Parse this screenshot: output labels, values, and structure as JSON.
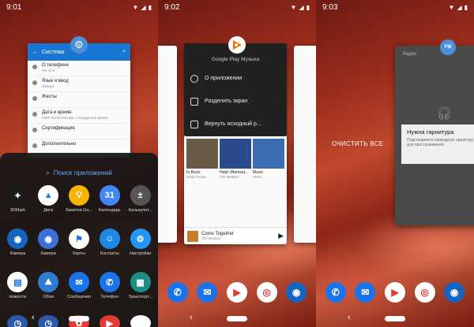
{
  "panels": [
    {
      "time": "9:01",
      "settings_card": {
        "title": "Система",
        "rows": [
          {
            "label": "О телефоне",
            "sub": "Pie 11.0"
          },
          {
            "label": "Язык и ввод",
            "sub": "Gboard"
          },
          {
            "label": "Жесты",
            "sub": ""
          },
          {
            "label": "Дата и время",
            "sub": "GMT+03:00 Москва, стандартное время"
          },
          {
            "label": "Сертификация",
            "sub": ""
          },
          {
            "label": "Дополнительно",
            "sub": ""
          }
        ]
      },
      "drawer": {
        "search_placeholder": "Поиск приложений",
        "apps": [
          {
            "label": "3DMark",
            "icon": "3dmark-icon",
            "color": "#1a1a1a"
          },
          {
            "label": "Диск",
            "icon": "drive-icon",
            "color": "#ffffff"
          },
          {
            "label": "Заметки Go...",
            "icon": "keep-icon",
            "color": "#f6b400"
          },
          {
            "label": "Календарь",
            "icon": "calendar-icon",
            "color": "#4285f4"
          },
          {
            "label": "Калькулят...",
            "icon": "calculator-icon",
            "color": "#555555"
          },
          {
            "label": "Камера",
            "icon": "camera-icon",
            "color": "#1565c0"
          },
          {
            "label": "Камера",
            "icon": "camera2-icon",
            "color": "#3d6fd8"
          },
          {
            "label": "Карты",
            "icon": "maps-icon",
            "color": "#ffffff"
          },
          {
            "label": "Контакты",
            "icon": "contacts-icon",
            "color": "#1e88e5"
          },
          {
            "label": "Настройки",
            "icon": "settings-icon",
            "color": "#2196f3"
          },
          {
            "label": "Новости",
            "icon": "news-icon",
            "color": "#ffffff"
          },
          {
            "label": "Обои",
            "icon": "wallpapers-icon",
            "color": "#2e7dd2"
          },
          {
            "label": "Сообщения",
            "icon": "messages-icon",
            "color": "#1a73e8"
          },
          {
            "label": "Телефон",
            "icon": "phone-icon",
            "color": "#1a73e8"
          },
          {
            "label": "Транспорт...",
            "icon": "transport-icon",
            "color": "#1b8f86"
          }
        ],
        "bottom_row_icons": [
          "clock-icon",
          "clock-icon",
          "photos-icon",
          "youtube-icon",
          "chrome-icon"
        ]
      }
    },
    {
      "time": "9:02",
      "music_header": "Google Play Музыка",
      "menu": [
        {
          "label": "О приложении",
          "icon": "info-icon"
        },
        {
          "label": "Разделить экран",
          "icon": "split-screen-icon"
        },
        {
          "label": "Вернуть исходный р...",
          "icon": "restore-size-icon"
        }
      ],
      "albums": [
        {
          "title": "In Rock",
          "sub": "Deep Purple"
        },
        {
          "title": "Help! (Remast...",
          "sub": "The Beatles"
        },
        {
          "title": "Music",
          "sub": "Music"
        }
      ],
      "now_playing": {
        "title": "Come Together",
        "sub": "The Beatles"
      }
    },
    {
      "time": "9:03",
      "clear_all": "ОЧИСТИТЬ ВСЕ",
      "fm_badge": "FM",
      "fm_title": "Радио",
      "dialog": {
        "title": "Нужна гарнитура",
        "body": "Подсоедините проводную гарнитуру для прослушивания."
      }
    }
  ],
  "dock": [
    "phone-icon",
    "messages-icon",
    "play-store-icon",
    "chrome-icon",
    "camera-icon"
  ],
  "colors": {
    "accent": "#1a73e8"
  }
}
